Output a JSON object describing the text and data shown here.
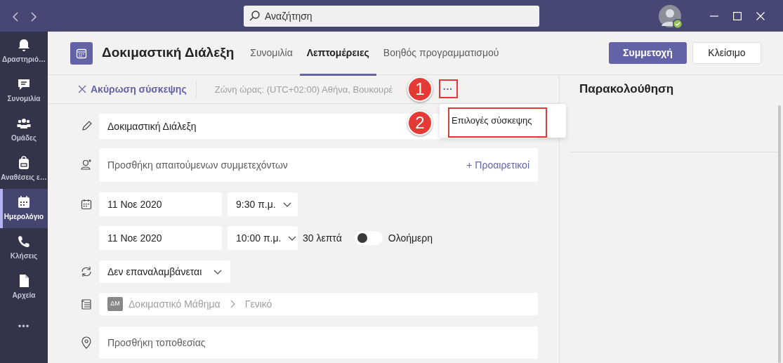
{
  "window": {
    "search": {
      "placeholder": "Αναζήτηση"
    }
  },
  "sidebar": {
    "items": [
      {
        "label": "Δραστηριό…",
        "selected": false
      },
      {
        "label": "Συνομιλία",
        "selected": false
      },
      {
        "label": "Ομάδες",
        "selected": false
      },
      {
        "label": "Αναθέσεις ε…",
        "selected": false
      },
      {
        "label": "Ημερολόγιο",
        "selected": true
      },
      {
        "label": "Κλήσεις",
        "selected": false
      },
      {
        "label": "Αρχεία",
        "selected": false
      }
    ],
    "more": "•••"
  },
  "meeting": {
    "title": "Δοκιμαστική Διάλεξη",
    "tabs": [
      {
        "label": "Συνομιλία",
        "selected": false
      },
      {
        "label": "Λεπτομέρειες",
        "selected": true
      },
      {
        "label": "Βοηθός προγραμματισμού",
        "selected": false
      }
    ],
    "join_button": "Συμμετοχή",
    "close_button": "Κλείσιμο"
  },
  "toolbar": {
    "cancel": "Ακύρωση σύσκεψης",
    "timezone": "Ζώνη ώρας: (UTC+02:00) Αθήνα, Βουκουρέ",
    "more": "···"
  },
  "menu": {
    "items": [
      "Επιλογές σύσκεψης"
    ]
  },
  "form": {
    "title_value": "Δοκιμαστική Διάλεξη",
    "attendees_placeholder": "Προσθήκη απαιτούμενων συμμετεχόντων",
    "optional_link": "+ Προαιρετικοί",
    "start_date": "11 Νοε 2020",
    "start_time": "9:30 π.μ.",
    "end_date": "11 Νοε 2020",
    "end_time": "10:00 π.μ.",
    "duration": "30 λεπτά",
    "all_day": {
      "label": "Ολοήμερη",
      "on": false
    },
    "repeat": "Δεν επαναλαμβάνεται",
    "channel": {
      "badge": "ΔΜ",
      "team": "Δοκιμαστικό Μάθημα",
      "name": "Γενικό"
    },
    "location_placeholder": "Προσθήκη τοποθεσίας"
  },
  "tracking": {
    "title": "Παρακολούθηση"
  },
  "annotations": [
    {
      "label": "1"
    },
    {
      "label": "2"
    }
  ]
}
